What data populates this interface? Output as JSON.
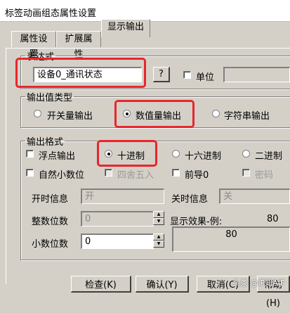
{
  "window": {
    "title": "标签动画组态属性设置"
  },
  "tabs": [
    {
      "label": "属性设置"
    },
    {
      "label": "扩展属性"
    },
    {
      "label": "显示输出"
    }
  ],
  "expression": {
    "legend": "表达式",
    "value": "设备0_通讯状态",
    "browse_button": "?",
    "unit_label": "单位",
    "unit_value": ""
  },
  "output_type": {
    "legend": "输出值类型",
    "options": [
      "开关量输出",
      "数值量输出",
      "字符串输出"
    ],
    "selected": "数值量输出"
  },
  "output_format": {
    "legend": "输出格式",
    "float_output": "浮点输出",
    "base_options": [
      "十进制",
      "十六进制",
      "二进制"
    ],
    "base_selected": "十进制",
    "natural_decimal": "自然小数位",
    "round": "四舍五入",
    "leading_zero": "前导0",
    "password": "密码",
    "on_label": "开时信息",
    "on_value": "开",
    "off_label": "关时信息",
    "off_value": "关",
    "int_digits_label": "整数位数",
    "int_digits_value": "0",
    "decimal_digits_label": "小数位数",
    "decimal_digits_value": "0",
    "preview_label": "显示效果-例:",
    "preview_example": "80",
    "preview_value": "80"
  },
  "buttons": {
    "check": "检查(K)",
    "ok": "确认(Y)",
    "cancel": "取消(C)",
    "help": "帮助(H)"
  },
  "watermark": "头条 @iP知AIF",
  "colors": {
    "highlight": "#e8262b",
    "dialog_bg": "#d4d0c8"
  }
}
